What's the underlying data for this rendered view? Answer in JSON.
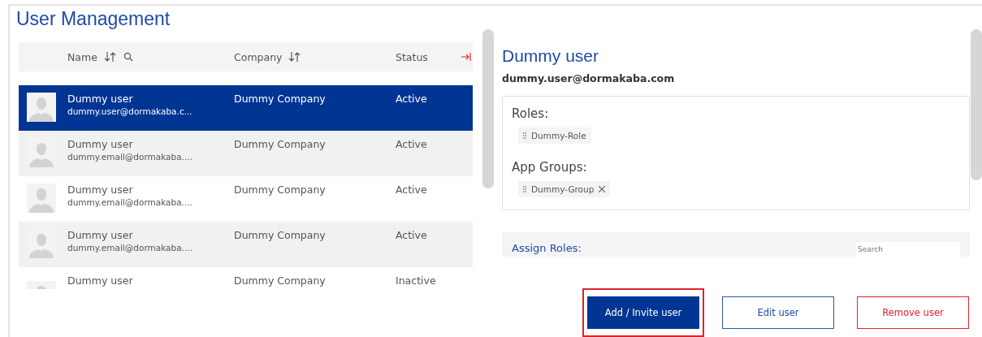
{
  "title": "User Management",
  "table": {
    "columns": [
      {
        "label": "Name",
        "icons": [
          {
            "kind": "sort"
          },
          {
            "kind": "search"
          }
        ]
      },
      {
        "label": "Company",
        "icons": [
          {
            "kind": "sort"
          }
        ]
      },
      {
        "label": "Status",
        "icons": [
          {
            "kind": "collapse"
          }
        ]
      }
    ],
    "rows": [
      {
        "name": "Dummy user",
        "email": "dummy.user@dormakaba.c...",
        "company": "Dummy Company",
        "status": "Active",
        "selected": true
      },
      {
        "name": "Dummy user",
        "email": "dummy.email@dormakaba....",
        "company": "Dummy Company",
        "status": "Active",
        "selected": false
      },
      {
        "name": "Dummy user",
        "email": "dummy.email@dormakaba....",
        "company": "Dummy Company",
        "status": "Active",
        "selected": false
      },
      {
        "name": "Dummy user",
        "email": "dummy.email@dormakaba....",
        "company": "Dummy Company",
        "status": "Active",
        "selected": false
      },
      {
        "name": "Dummy user",
        "company": "Dummy Company",
        "status": "Inactive",
        "selected": false
      }
    ]
  },
  "detail": {
    "name": "Dummy user",
    "email": "dummy.user@dormakaba.com",
    "sections": [
      {
        "label": "Roles:",
        "chips": [
          {
            "label": "Dummy-Role",
            "kind": "fixed"
          }
        ]
      },
      {
        "label": "App Groups:",
        "chips": [
          {
            "label": "Dummy-Group",
            "kind": "removable"
          }
        ]
      }
    ],
    "assign": {
      "label": "Assign Roles:",
      "search": {
        "placeholder": "Search"
      }
    }
  },
  "buttons": [
    {
      "label": "Add / Invite user",
      "kind": "primary",
      "highlighted": true
    },
    {
      "label": "Edit user",
      "kind": "secondary",
      "highlighted": false
    },
    {
      "label": "Remove user",
      "kind": "danger",
      "highlighted": false
    }
  ]
}
